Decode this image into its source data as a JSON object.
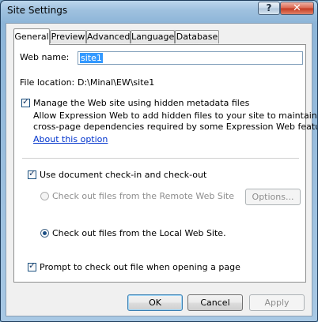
{
  "window": {
    "title": "Site Settings",
    "help_label": "?",
    "close_label": "✕"
  },
  "tabs": [
    {
      "label": "General"
    },
    {
      "label": "Preview"
    },
    {
      "label": "Advanced"
    },
    {
      "label": "Language"
    },
    {
      "label": "Database"
    }
  ],
  "general": {
    "web_name_label": "Web name:",
    "web_name_value": "site1",
    "file_location_label": "File location:",
    "file_location_value": "D:\\Minal\\EW\\site1",
    "metadata_checkbox_label": "Manage the Web site using hidden metadata files",
    "metadata_desc_line1": "Allow Expression Web to add hidden files to your site to maintain",
    "metadata_desc_line2": "cross-page dependencies required by some Expression Web features.",
    "about_link": "About this option",
    "checkin_checkbox_label": "Use document check-in and check-out",
    "remote_radio_label": "Check out files from the Remote Web Site",
    "options_button": "Options...",
    "local_radio_label": "Check out files from the Local Web Site.",
    "prompt_checkbox_label": "Prompt to check out file when opening a page"
  },
  "footer": {
    "ok": "OK",
    "cancel": "Cancel",
    "apply": "Apply"
  }
}
